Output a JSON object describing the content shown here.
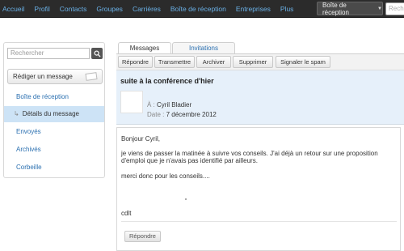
{
  "topnav": {
    "items": [
      "Accueil",
      "Profil",
      "Contacts",
      "Groupes",
      "Carrières",
      "Boîte de réception",
      "Entreprises",
      "Plus"
    ],
    "inbox_dropdown": "Boîte de réception",
    "search_placeholder": "Rechercher"
  },
  "sidebar": {
    "search_placeholder": "Rechercher",
    "compose_label": "Rédiger un message",
    "items": [
      {
        "label": "Boîte de réception"
      },
      {
        "label": "Détails du message"
      },
      {
        "label": "Envoyés"
      },
      {
        "label": "Archivés"
      },
      {
        "label": "Corbeille"
      }
    ]
  },
  "tabs": [
    "Messages",
    "Invitations"
  ],
  "toolbar": [
    "Répondre",
    "Transmettre",
    "Archiver",
    "Supprimer",
    "Signaler le spam"
  ],
  "message": {
    "subject": "suite à la conférence d'hier",
    "to_label": "À :",
    "to_value": "Cyril Bladier",
    "date_label": "Date :",
    "date_value": "7 décembre 2012",
    "body": [
      "Bonjour Cyril,",
      "je viens de passer la matinée à suivre vos conseils. J'ai déjà un retour sur une proposition",
      "d'emploi que je n'avais pas identifié par ailleurs.",
      "merci donc pour les conseils....",
      "cdlt"
    ],
    "reply_label": "Répondre"
  }
}
